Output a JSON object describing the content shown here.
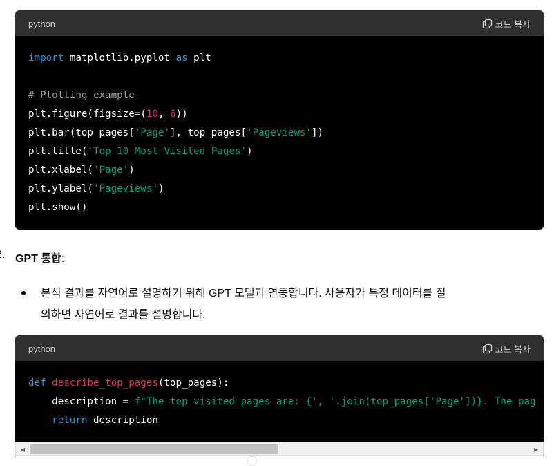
{
  "block1": {
    "language": "python",
    "copy_label": "코드 복사",
    "lines": [
      [
        {
          "t": "import",
          "c": "kw"
        },
        {
          "t": " matplotlib.pyplot ",
          "c": ""
        },
        {
          "t": "as",
          "c": "kw"
        },
        {
          "t": " plt",
          "c": ""
        }
      ],
      [],
      [
        {
          "t": "# Plotting example",
          "c": "cm"
        }
      ],
      [
        {
          "t": "plt.figure(figsize=(",
          "c": ""
        },
        {
          "t": "10",
          "c": "num"
        },
        {
          "t": ", ",
          "c": ""
        },
        {
          "t": "6",
          "c": "num"
        },
        {
          "t": "))",
          "c": ""
        }
      ],
      [
        {
          "t": "plt.bar(top_pages[",
          "c": ""
        },
        {
          "t": "'Page'",
          "c": "str"
        },
        {
          "t": "], top_pages[",
          "c": ""
        },
        {
          "t": "'Pageviews'",
          "c": "str"
        },
        {
          "t": "])",
          "c": ""
        }
      ],
      [
        {
          "t": "plt.title(",
          "c": ""
        },
        {
          "t": "'Top 10 Most Visited Pages'",
          "c": "str"
        },
        {
          "t": ")",
          "c": ""
        }
      ],
      [
        {
          "t": "plt.xlabel(",
          "c": ""
        },
        {
          "t": "'Page'",
          "c": "str"
        },
        {
          "t": ")",
          "c": ""
        }
      ],
      [
        {
          "t": "plt.ylabel(",
          "c": ""
        },
        {
          "t": "'Pageviews'",
          "c": "str"
        },
        {
          "t": ")",
          "c": ""
        }
      ],
      [
        {
          "t": "plt.show()",
          "c": ""
        }
      ]
    ]
  },
  "section": {
    "number": "2.",
    "title": "GPT 통합",
    "title_suffix": ":"
  },
  "bullet": {
    "line1": "분석 결과를 자연어로 설명하기 위해 GPT 모델과 연동합니다. 사용자가 특정 데이터를 질",
    "line2": "의하면 자연어로 결과를 설명합니다."
  },
  "block2": {
    "language": "python",
    "copy_label": "코드 복사",
    "lines": [
      [
        {
          "t": "def",
          "c": "kw"
        },
        {
          "t": " ",
          "c": ""
        },
        {
          "t": "describe_top_pages",
          "c": "fn"
        },
        {
          "t": "(top_pages):",
          "c": ""
        }
      ],
      [
        {
          "t": "    description = ",
          "c": ""
        },
        {
          "t": "f\"The top visited pages are: {', '.join(top_pages['Page'])}. The pag",
          "c": "str"
        }
      ],
      [
        {
          "t": "    ",
          "c": ""
        },
        {
          "t": "return",
          "c": "kw"
        },
        {
          "t": " description",
          "c": ""
        }
      ]
    ]
  },
  "colors": {
    "keyword": "#2e95d3",
    "string": "#00a67d",
    "number": "#df3079",
    "comment": "#999999",
    "function": "#f22c3d"
  },
  "icons": {
    "copy": "copy-icon",
    "scroll_left": "scroll-left-arrow-icon",
    "scroll_right": "scroll-right-arrow-icon"
  }
}
